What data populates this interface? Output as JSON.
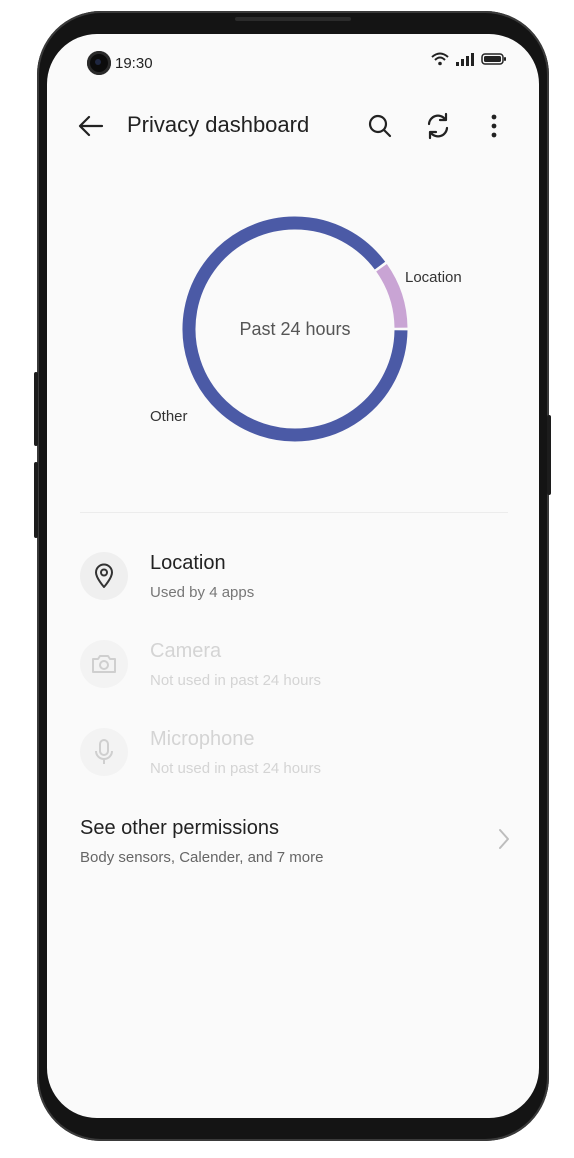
{
  "status_bar": {
    "time": "19:30"
  },
  "app_bar": {
    "title": "Privacy dashboard",
    "icons": [
      "back-arrow-icon",
      "search-icon",
      "refresh-icon",
      "more-vert-icon"
    ]
  },
  "chart_data": {
    "type": "pie",
    "center_label": "Past 24 hours",
    "categories": [
      "Location",
      "Other"
    ],
    "values": [
      0.1,
      0.9
    ],
    "colors": {
      "Location": "#c9a4d4",
      "Other": "#4b5aa6"
    }
  },
  "permissions": [
    {
      "title": "Location",
      "subtitle": "Used by 4 apps",
      "icon": "location-pin-icon",
      "enabled": true
    },
    {
      "title": "Camera",
      "subtitle": "Not used in past 24 hours",
      "icon": "camera-icon",
      "enabled": false
    },
    {
      "title": "Microphone",
      "subtitle": "Not used in past 24 hours",
      "icon": "microphone-icon",
      "enabled": false
    }
  ],
  "other_permissions": {
    "title": "See other permissions",
    "subtitle": "Body sensors, Calender, and 7 more"
  }
}
